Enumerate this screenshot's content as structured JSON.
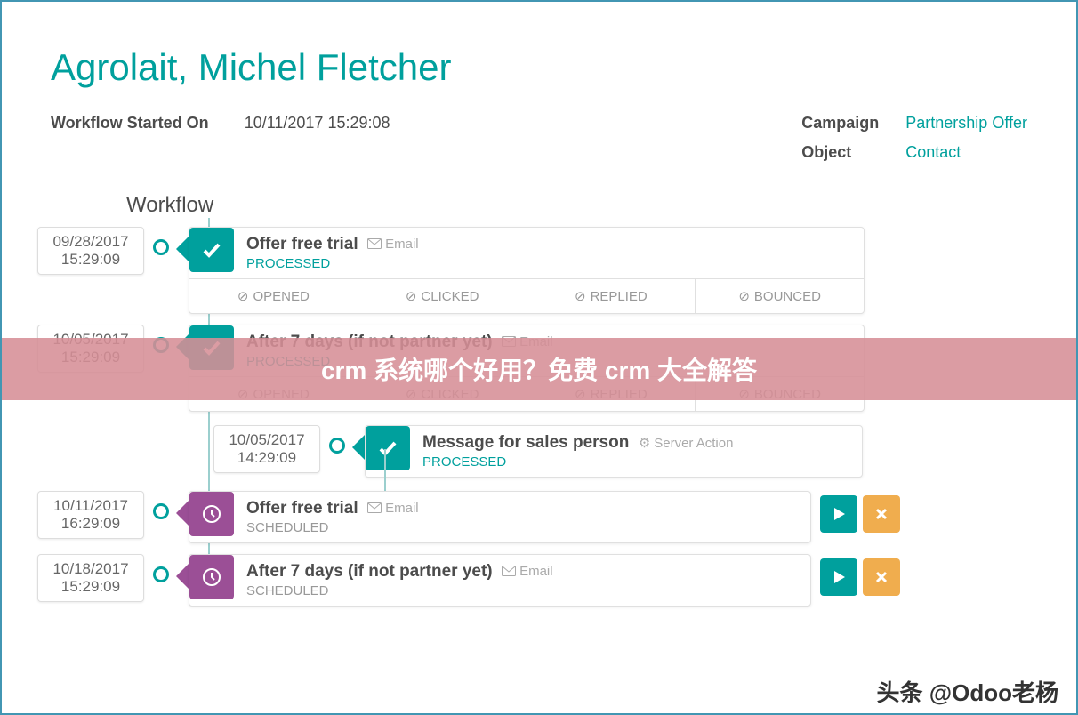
{
  "title": "Agrolait, Michel Fletcher",
  "meta": {
    "startedLabel": "Workflow Started On",
    "startedValue": "10/11/2017 15:29:08",
    "campaignLabel": "Campaign",
    "campaignValue": "Partnership Offer",
    "objectLabel": "Object",
    "objectValue": "Contact"
  },
  "workflowLabel": "Workflow",
  "emailLabel": "Email",
  "serverActionLabel": "Server Action",
  "statusProcessed": "PROCESSED",
  "statusScheduled": "SCHEDULED",
  "metrics": {
    "opened": "OPENED",
    "clicked": "CLICKED",
    "replied": "REPLIED",
    "bounced": "BOUNCED"
  },
  "nodes": [
    {
      "date": "09/28/2017",
      "time": "15:29:09",
      "title": "Offer free trial",
      "type": "email",
      "status": "processed",
      "color": "teal",
      "showMetrics": true
    },
    {
      "date": "10/05/2017",
      "time": "15:29:09",
      "title": "After 7 days (if not partner yet)",
      "type": "email",
      "status": "processed",
      "color": "teal",
      "showMetrics": true
    },
    {
      "date": "10/05/2017",
      "time": "14:29:09",
      "title": "Message for sales person",
      "type": "server",
      "status": "processed",
      "color": "teal",
      "nested": true
    },
    {
      "date": "10/11/2017",
      "time": "16:29:09",
      "title": "Offer free trial",
      "type": "email",
      "status": "scheduled",
      "color": "purple",
      "actions": true
    },
    {
      "date": "10/18/2017",
      "time": "15:29:09",
      "title": "After 7 days (if not partner yet)",
      "type": "email",
      "status": "scheduled",
      "color": "purple",
      "actions": true
    }
  ],
  "overlayText": "crm 系统哪个好用？免费 crm 大全解答",
  "footerTag": "头条 @Odoo老杨"
}
